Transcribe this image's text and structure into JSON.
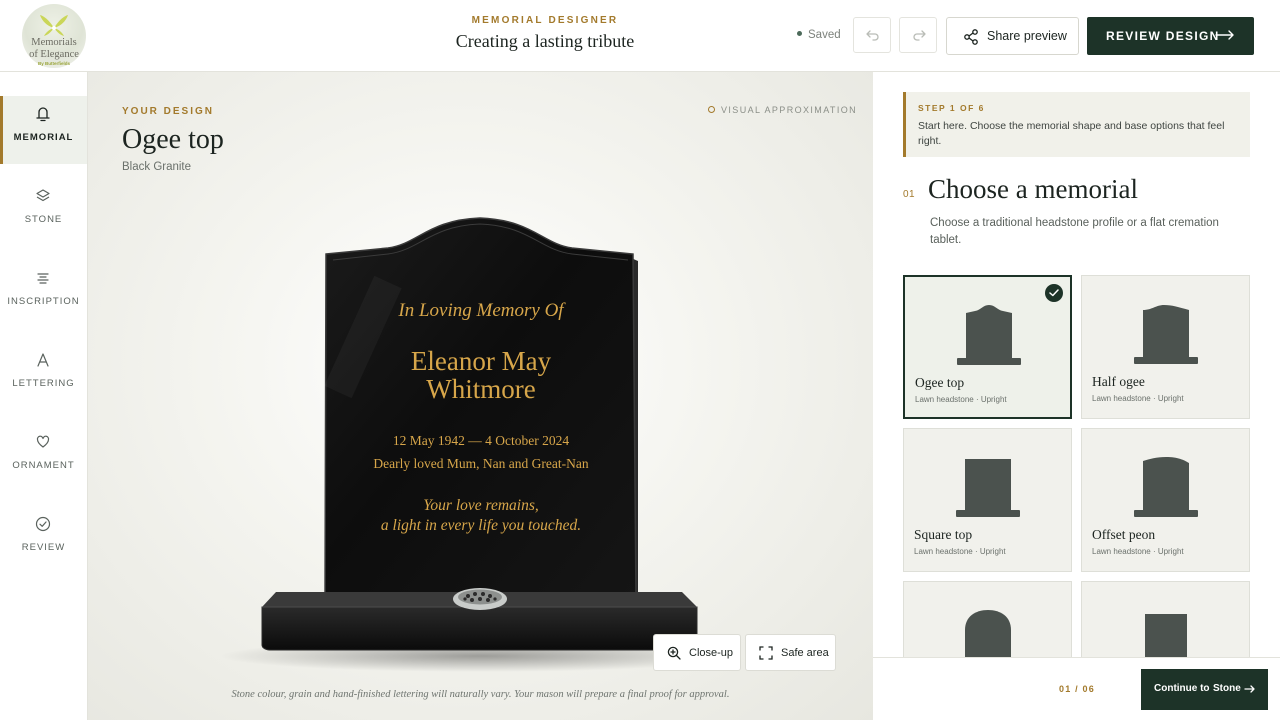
{
  "brand": {
    "name_line1": "Memorials",
    "name_line2": "of Elegance",
    "tagline": "By Butterfields",
    "colors": {
      "primary": "#1d3328",
      "accent": "#a37a2c",
      "engraving": "#d7a64a"
    }
  },
  "header": {
    "kicker": "MEMORIAL DESIGNER",
    "title": "Creating a lasting tribute",
    "status": "Saved",
    "undo_icon": "undo-icon",
    "redo_icon": "redo-icon",
    "share_label": "Share preview",
    "review_label": "REVIEW DESIGN"
  },
  "nav": {
    "items": [
      {
        "label": "MEMORIAL",
        "icon": "bell-headstone-icon",
        "active": true
      },
      {
        "label": "STONE",
        "icon": "layers-icon",
        "active": false
      },
      {
        "label": "INSCRIPTION",
        "icon": "text-lines-icon",
        "active": false
      },
      {
        "label": "LETTERING",
        "icon": "letter-a-icon",
        "active": false
      },
      {
        "label": "ORNAMENT",
        "icon": "heart-icon",
        "active": false
      },
      {
        "label": "REVIEW",
        "icon": "check-circle-icon",
        "active": false
      }
    ]
  },
  "preview": {
    "kicker": "YOUR DESIGN",
    "design_name": "Ogee top",
    "stone": "Black Granite",
    "approx_label": "VISUAL APPROXIMATION",
    "inscription": {
      "heading": "In Loving Memory Of",
      "name_line1": "Eleanor May",
      "name_line2": "Whitmore",
      "dates": "12 May 1942 — 4 October 2024",
      "tribute": "Dearly loved Mum, Nan and Great-Nan",
      "verse_line1": "Your love remains,",
      "verse_line2": "a light in every life you touched."
    },
    "closeup_label": "Close-up",
    "safe_area_label": "Safe area",
    "disclaimer": "Stone colour, grain and hand-finished lettering will naturally vary. Your mason will prepare a final proof for approval."
  },
  "panel": {
    "step_kicker": "STEP 1 OF 6",
    "step_text": "Start here. Choose the memorial shape and base options that feel right.",
    "section_number": "01",
    "section_title": "Choose a memorial",
    "section_desc": "Choose a traditional headstone profile or a flat cremation tablet.",
    "options": [
      {
        "title": "Ogee top",
        "subtitle": "Lawn headstone · Upright",
        "selected": true,
        "shape": "ogee"
      },
      {
        "title": "Half ogee",
        "subtitle": "Lawn headstone · Upright",
        "selected": false,
        "shape": "half-ogee"
      },
      {
        "title": "Square top",
        "subtitle": "Lawn headstone · Upright",
        "selected": false,
        "shape": "square"
      },
      {
        "title": "Offset peon",
        "subtitle": "Lawn headstone · Upright",
        "selected": false,
        "shape": "offset-peon"
      },
      {
        "title": "",
        "subtitle": "",
        "selected": false,
        "shape": "round"
      },
      {
        "title": "",
        "subtitle": "",
        "selected": false,
        "shape": "square-plain"
      }
    ],
    "progress": "01 / 06",
    "continue_prefix": "Continue to",
    "continue_target": "Stone"
  }
}
